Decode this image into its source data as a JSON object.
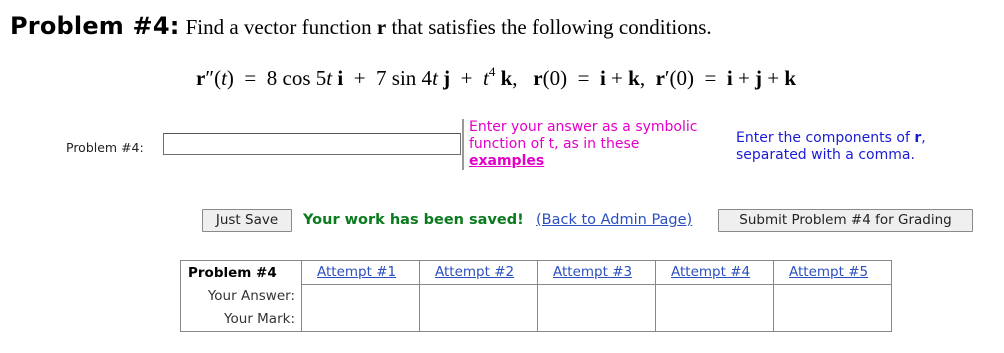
{
  "heading": {
    "problem_number": "Problem #4:",
    "description_before": "Find a vector function",
    "symbol": "r",
    "description_after": "that satisfies the following conditions."
  },
  "equation": {
    "lhs": "r″(t) = 8 cos 5t i + 7 sin 4t j + t⁴ k,  r(0) = i + k,  r′(0) = i + j + k"
  },
  "answer": {
    "label": "Problem #4:",
    "value": ""
  },
  "hint_symbolic": {
    "text": "Enter your answer as a symbolic function of t, as in these",
    "link": "examples"
  },
  "hint_components": {
    "text_before": "Enter the components of",
    "symbol": "r",
    "text_after": ", separated with a comma."
  },
  "actions": {
    "save_label": "Just Save",
    "saved_message": "Your work has been saved!",
    "admin_link": "(Back to Admin Page)",
    "submit_label": "Submit Problem #4 for Grading"
  },
  "attempts_table": {
    "corner": "Problem #4",
    "columns": [
      "Attempt #1",
      "Attempt #2",
      "Attempt #3",
      "Attempt #4",
      "Attempt #5"
    ],
    "row_labels": [
      "Your Answer:",
      "Your Mark:"
    ]
  }
}
